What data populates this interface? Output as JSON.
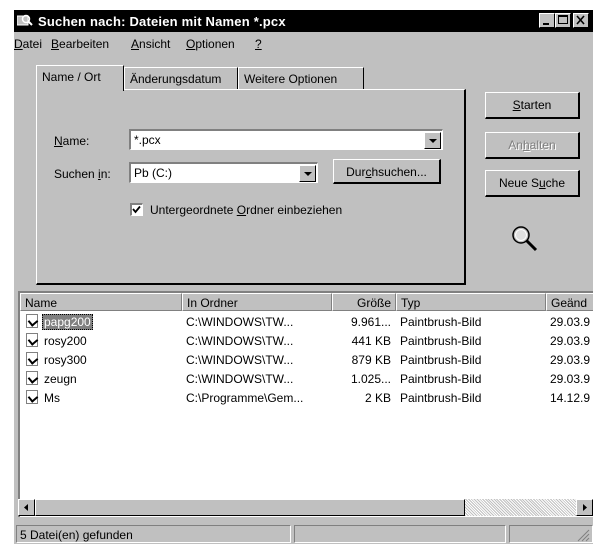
{
  "window": {
    "title": "Suchen nach: Dateien mit Namen *.pcx",
    "controls": [
      "minimize",
      "maximize",
      "close"
    ]
  },
  "menu": [
    {
      "pre": "",
      "u": "D",
      "post": "atei"
    },
    {
      "pre": "",
      "u": "B",
      "post": "earbeiten"
    },
    {
      "pre": "",
      "u": "A",
      "post": "nsicht"
    },
    {
      "pre": "",
      "u": "O",
      "post": "ptionen"
    },
    {
      "pre": "",
      "u": "?",
      "post": ""
    }
  ],
  "tabs": [
    {
      "label": "Name / Ort",
      "active": true
    },
    {
      "label": "Änderungsdatum",
      "active": false
    },
    {
      "label": "Weitere Optionen",
      "active": false
    }
  ],
  "form": {
    "name_label": {
      "pre": "",
      "u": "N",
      "post": "ame:"
    },
    "name_value": "*.pcx",
    "lookin_label": {
      "pre": "Suchen ",
      "u": "i",
      "post": "n:"
    },
    "lookin_value": "Pb (C:)",
    "browse_button": {
      "pre": "Dur",
      "u": "c",
      "post": "hsuchen..."
    },
    "subfolders_checked": true,
    "subfolders_label": {
      "pre": "Untergeordnete ",
      "u": "O",
      "post": "rdner einbeziehen"
    }
  },
  "actions": {
    "start": {
      "pre": "",
      "u": "S",
      "post": "tarten"
    },
    "stop": {
      "pre": "An",
      "u": "h",
      "post": "alten"
    },
    "new_search": {
      "pre": "Neue S",
      "u": "u",
      "post": "che"
    }
  },
  "results": {
    "columns": [
      "Name",
      "In Ordner",
      "Größe",
      "Typ",
      "Geänd"
    ],
    "rows": [
      {
        "name": "papg200",
        "folder": "C:\\WINDOWS\\TW...",
        "size": "9.961...",
        "type": "Paintbrush-Bild",
        "modified": "29.03.9",
        "selected": true
      },
      {
        "name": "rosy200",
        "folder": "C:\\WINDOWS\\TW...",
        "size": "441 KB",
        "type": "Paintbrush-Bild",
        "modified": "29.03.9",
        "selected": false
      },
      {
        "name": "rosy300",
        "folder": "C:\\WINDOWS\\TW...",
        "size": "879 KB",
        "type": "Paintbrush-Bild",
        "modified": "29.03.9",
        "selected": false
      },
      {
        "name": "zeugn",
        "folder": "C:\\WINDOWS\\TW...",
        "size": "1.025...",
        "type": "Paintbrush-Bild",
        "modified": "29.03.9",
        "selected": false
      },
      {
        "name": "Ms",
        "folder": "C:\\Programme\\Gem...",
        "size": "2 KB",
        "type": "Paintbrush-Bild",
        "modified": "14.12.9",
        "selected": false
      }
    ]
  },
  "status": {
    "text": "5 Datei(en) gefunden"
  }
}
